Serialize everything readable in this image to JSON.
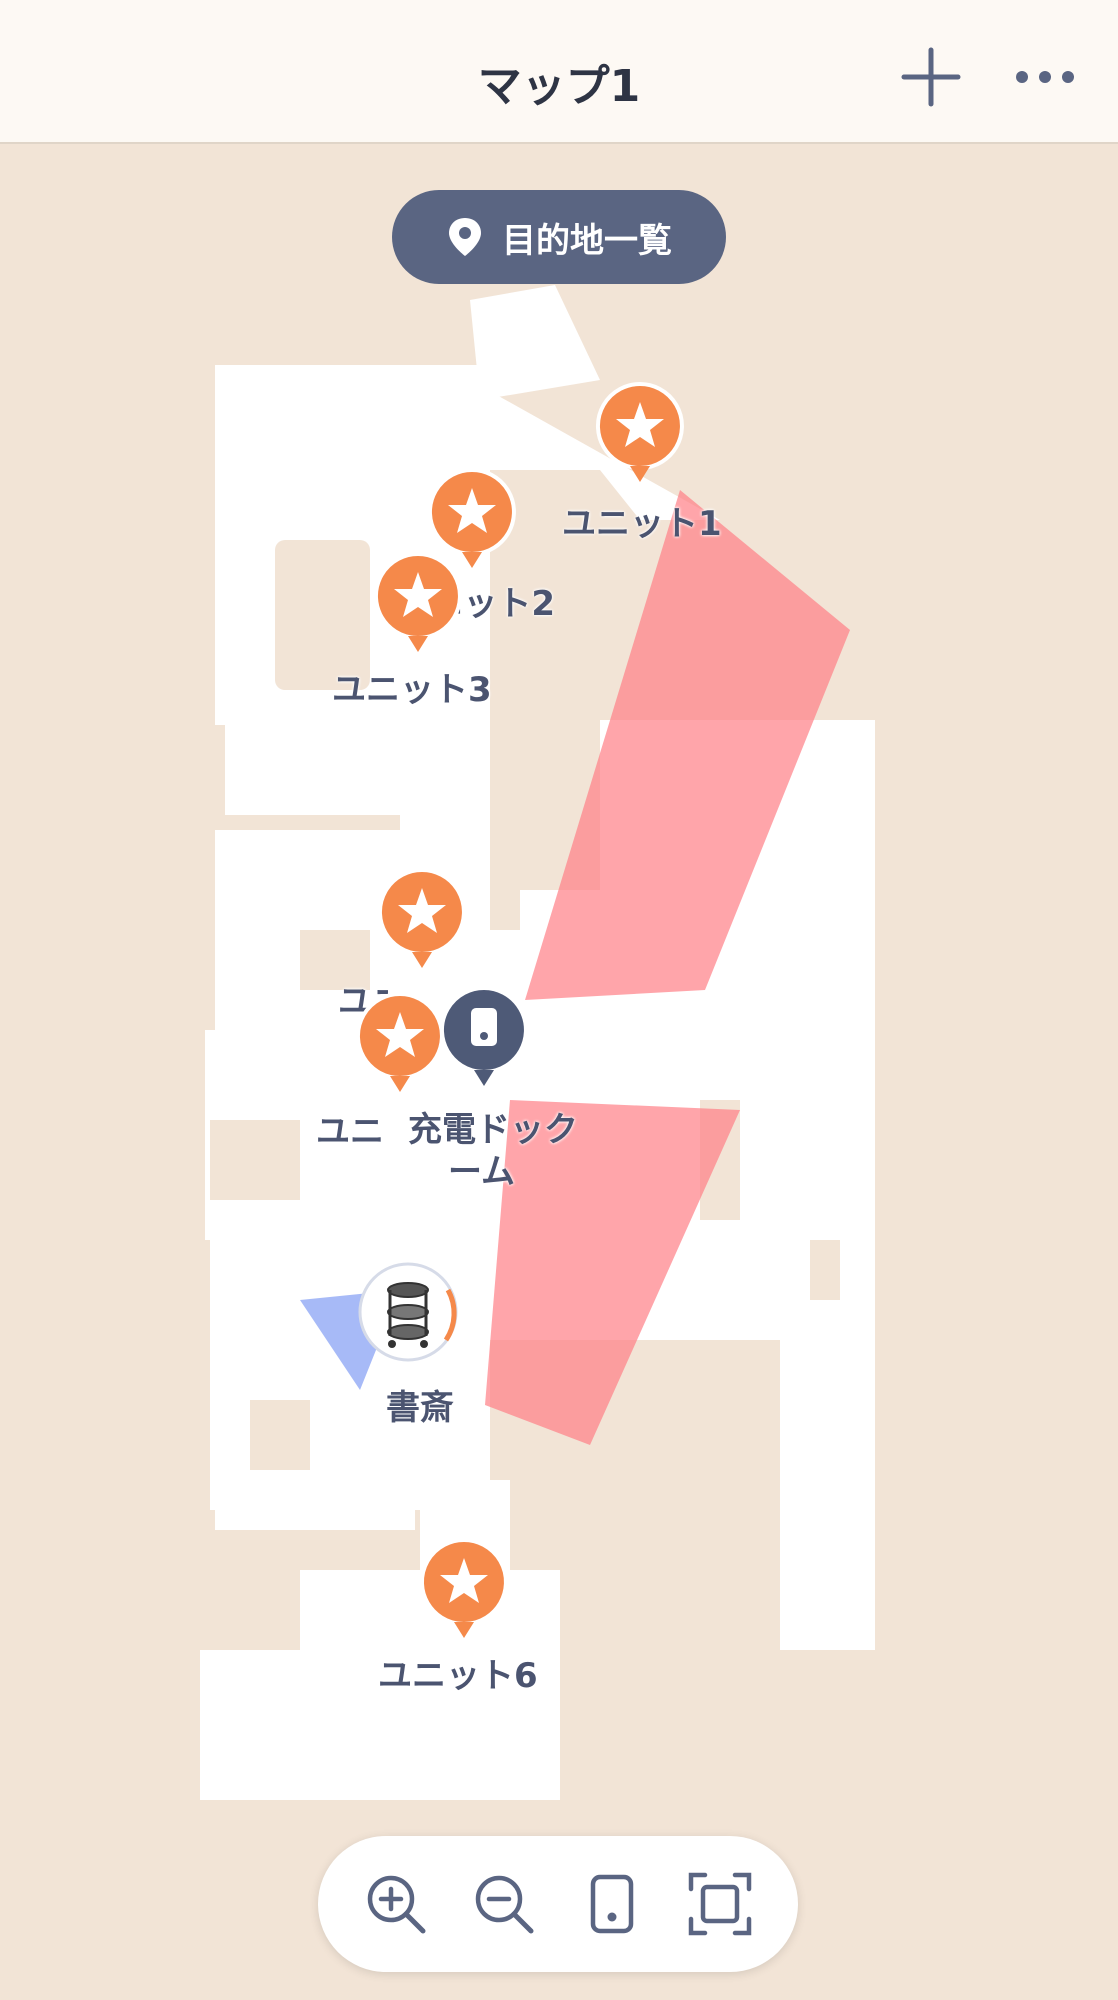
{
  "header": {
    "title": "マップ1",
    "add_icon": "plus-icon",
    "menu_icon": "more-horizontal-icon"
  },
  "map": {
    "destination_list_label": "目的地一覧",
    "destination_list_icon": "location-pin-icon",
    "units": [
      {
        "label": "ユニット1"
      },
      {
        "label": "ユニット2"
      },
      {
        "label": "ユニット3"
      },
      {
        "label": "ユニ"
      },
      {
        "label": "ユニ"
      },
      {
        "label": "ユニット6"
      }
    ],
    "dock_label_line1": "充電ドック",
    "dock_label_line2": "ーム",
    "robot_label": "書斎"
  },
  "toolbar": {
    "zoom_in_icon": "zoom-in-icon",
    "zoom_out_icon": "zoom-out-icon",
    "locate_robot_icon": "robot-device-icon",
    "fit_screen_icon": "fit-screen-icon"
  },
  "colors": {
    "marker": "#f5894a",
    "pill": "#5a6582",
    "no_go_zone": "#ff7f86",
    "floor": "#ffffff",
    "background": "#f2e4d6"
  }
}
